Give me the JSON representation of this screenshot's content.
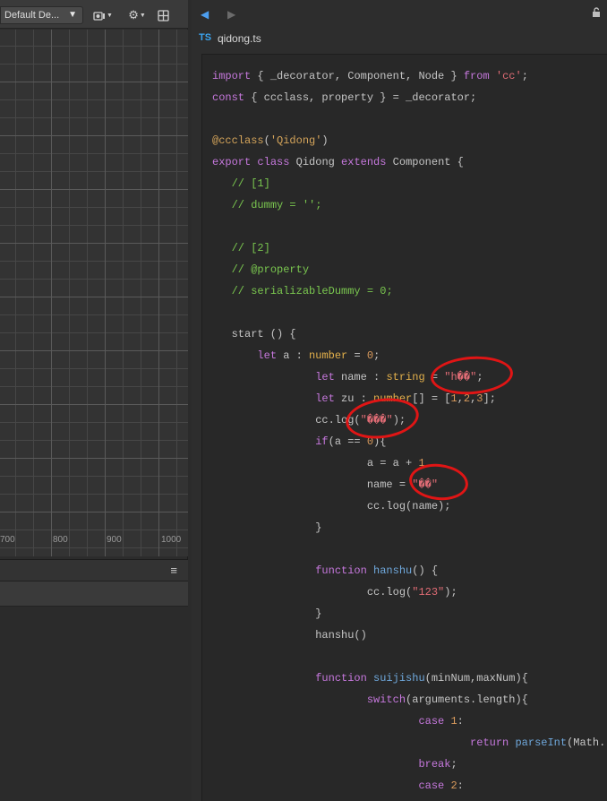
{
  "scene_toolbar": {
    "layout_select": "Default De...",
    "camera_icon": "camera-icon",
    "gear_icon": "gear-icon",
    "layout_icon": "layout-icon"
  },
  "scene_axis_ticks": [
    "700",
    "800",
    "900",
    "1000"
  ],
  "bottom_panel": {
    "menu_icon": "menu-icon"
  },
  "editor": {
    "tab_language": "TS",
    "file_name": "qidong.ts"
  },
  "code": [
    [
      [
        "kw",
        "import"
      ],
      [
        "plain",
        " { _decorator, Component, Node } "
      ],
      [
        "kw",
        "from"
      ],
      [
        "plain",
        " "
      ],
      [
        "str",
        "'cc'"
      ],
      [
        "plain",
        ";"
      ]
    ],
    [
      [
        "kw",
        "const"
      ],
      [
        "plain",
        " { ccclass, property } = _decorator;"
      ]
    ],
    [],
    [
      [
        "dec",
        "@ccclass"
      ],
      [
        "plain",
        "("
      ],
      [
        "dec",
        "'Qidong'"
      ],
      [
        "plain",
        ")"
      ]
    ],
    [
      [
        "kw",
        "export"
      ],
      [
        "plain",
        " "
      ],
      [
        "kw",
        "class"
      ],
      [
        "plain",
        " Qidong "
      ],
      [
        "kw",
        "extends"
      ],
      [
        "plain",
        " Component {"
      ]
    ],
    [
      [
        "plain",
        "   "
      ],
      [
        "cmt",
        "// [1]"
      ]
    ],
    [
      [
        "plain",
        "   "
      ],
      [
        "cmt",
        "// dummy = '';"
      ]
    ],
    [],
    [
      [
        "plain",
        "   "
      ],
      [
        "cmt",
        "// [2]"
      ]
    ],
    [
      [
        "plain",
        "   "
      ],
      [
        "cmt",
        "// @property"
      ]
    ],
    [
      [
        "plain",
        "   "
      ],
      [
        "cmt",
        "// serializableDummy = 0;"
      ]
    ],
    [],
    [
      [
        "plain",
        "   start () {"
      ]
    ],
    [
      [
        "plain",
        "       "
      ],
      [
        "kw",
        "let"
      ],
      [
        "plain",
        " a : "
      ],
      [
        "kwb",
        "number"
      ],
      [
        "plain",
        " = "
      ],
      [
        "num",
        "0"
      ],
      [
        "plain",
        ";"
      ]
    ],
    [
      [
        "plain",
        "                "
      ],
      [
        "kw",
        "let"
      ],
      [
        "plain",
        " name : "
      ],
      [
        "kwb",
        "string"
      ],
      [
        "plain",
        " = "
      ],
      [
        "str",
        "\"h��\""
      ],
      [
        "plain",
        ";"
      ]
    ],
    [
      [
        "plain",
        "                "
      ],
      [
        "kw",
        "let"
      ],
      [
        "plain",
        " zu : "
      ],
      [
        "kwb",
        "number"
      ],
      [
        "plain",
        "[] = ["
      ],
      [
        "num",
        "1"
      ],
      [
        "plain",
        ","
      ],
      [
        "num",
        "2"
      ],
      [
        "plain",
        ","
      ],
      [
        "num",
        "3"
      ],
      [
        "plain",
        "];"
      ]
    ],
    [
      [
        "plain",
        "                cc.log("
      ],
      [
        "str",
        "\"���\""
      ],
      [
        "plain",
        ");"
      ]
    ],
    [
      [
        "plain",
        "                "
      ],
      [
        "kw",
        "if"
      ],
      [
        "plain",
        "(a == "
      ],
      [
        "num",
        "0"
      ],
      [
        "plain",
        "){"
      ]
    ],
    [
      [
        "plain",
        "                        a = a + "
      ],
      [
        "num",
        "1"
      ]
    ],
    [
      [
        "plain",
        "                        name = "
      ],
      [
        "str",
        "\"��\""
      ]
    ],
    [
      [
        "plain",
        "                        cc.log(name);"
      ]
    ],
    [
      [
        "plain",
        "                }"
      ]
    ],
    [],
    [
      [
        "plain",
        "                "
      ],
      [
        "kw",
        "function"
      ],
      [
        "plain",
        " "
      ],
      [
        "fn",
        "hanshu"
      ],
      [
        "plain",
        "() {"
      ]
    ],
    [
      [
        "plain",
        "                        cc.log("
      ],
      [
        "str",
        "\"123\""
      ],
      [
        "plain",
        ");"
      ]
    ],
    [
      [
        "plain",
        "                }"
      ]
    ],
    [
      [
        "plain",
        "                hanshu()"
      ]
    ],
    [],
    [
      [
        "plain",
        "                "
      ],
      [
        "kw",
        "function"
      ],
      [
        "plain",
        " "
      ],
      [
        "fn",
        "suijishu"
      ],
      [
        "plain",
        "(minNum,maxNum){"
      ]
    ],
    [
      [
        "plain",
        "                        "
      ],
      [
        "kw",
        "switch"
      ],
      [
        "plain",
        "(arguments.length){"
      ]
    ],
    [
      [
        "plain",
        "                                "
      ],
      [
        "kw",
        "case"
      ],
      [
        "plain",
        " "
      ],
      [
        "num",
        "1"
      ],
      [
        "plain",
        ":"
      ]
    ],
    [
      [
        "plain",
        "                                        "
      ],
      [
        "kw",
        "return"
      ],
      [
        "plain",
        " "
      ],
      [
        "fn",
        "parseInt"
      ],
      [
        "plain",
        "(Math."
      ]
    ],
    [
      [
        "plain",
        "                                "
      ],
      [
        "kw",
        "break"
      ],
      [
        "plain",
        ";"
      ]
    ],
    [
      [
        "plain",
        "                                "
      ],
      [
        "kw",
        "case"
      ],
      [
        "plain",
        " "
      ],
      [
        "num",
        "2"
      ],
      [
        "plain",
        ":"
      ]
    ]
  ],
  "colors": {
    "keyword": "#c678dd",
    "type": "#e3b04b",
    "string": "#e06c75",
    "comment": "#7ac74f",
    "function": "#6fa8dc",
    "annotation": "#e01515"
  }
}
